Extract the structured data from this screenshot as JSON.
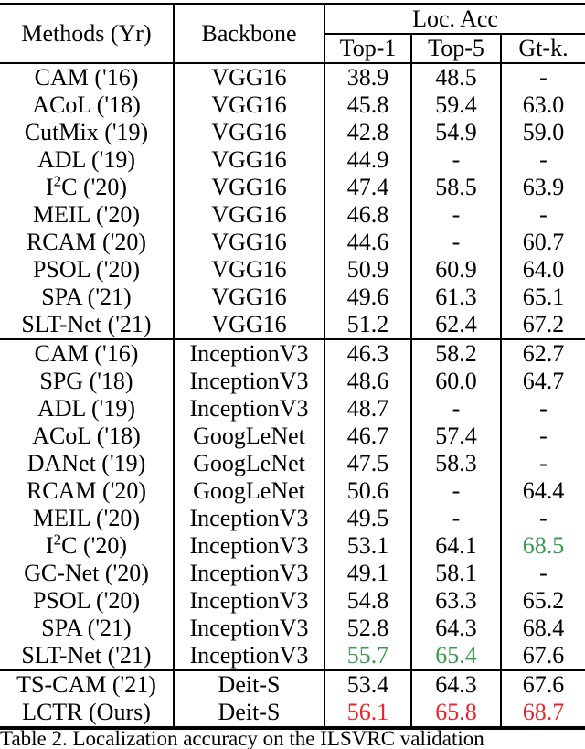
{
  "table": {
    "columns": {
      "methods": "Methods (Yr)",
      "backbone": "Backbone",
      "group_header": "Loc. Acc",
      "top1": "Top-1",
      "top5": "Top-5",
      "gtk": "Gt-k."
    },
    "colors": {
      "green": "#3a9b50",
      "red": "#e8252a",
      "rule": "#000000"
    },
    "groups": [
      {
        "name": "vgg16-group",
        "rows": [
          {
            "method": "CAM",
            "year": "('16)",
            "sup": "",
            "backbone": "VGG16",
            "top1": "38.9",
            "top5": "48.5",
            "gtk": "-",
            "top1_style": "",
            "top5_style": "",
            "gtk_style": ""
          },
          {
            "method": "ACoL",
            "year": "('18)",
            "sup": "",
            "backbone": "VGG16",
            "top1": "45.8",
            "top5": "59.4",
            "gtk": "63.0",
            "top1_style": "",
            "top5_style": "",
            "gtk_style": ""
          },
          {
            "method": "CutMix",
            "year": "('19)",
            "sup": "",
            "backbone": "VGG16",
            "top1": "42.8",
            "top5": "54.9",
            "gtk": "59.0",
            "top1_style": "",
            "top5_style": "",
            "gtk_style": ""
          },
          {
            "method": "ADL",
            "year": "('19)",
            "sup": "",
            "backbone": "VGG16",
            "top1": "44.9",
            "top5": "-",
            "gtk": "-",
            "top1_style": "",
            "top5_style": "",
            "gtk_style": ""
          },
          {
            "method": "I",
            "year": "('20)",
            "sup": "2",
            "method_tail": "C",
            "backbone": "VGG16",
            "top1": "47.4",
            "top5": "58.5",
            "gtk": "63.9",
            "top1_style": "",
            "top5_style": "",
            "gtk_style": ""
          },
          {
            "method": "MEIL",
            "year": "('20)",
            "sup": "",
            "backbone": "VGG16",
            "top1": "46.8",
            "top5": "-",
            "gtk": "-",
            "top1_style": "",
            "top5_style": "",
            "gtk_style": ""
          },
          {
            "method": "RCAM",
            "year": "('20)",
            "sup": "",
            "backbone": "VGG16",
            "top1": "44.6",
            "top5": "-",
            "gtk": "60.7",
            "top1_style": "",
            "top5_style": "",
            "gtk_style": ""
          },
          {
            "method": "PSOL",
            "year": "('20)",
            "sup": "",
            "backbone": "VGG16",
            "top1": "50.9",
            "top5": "60.9",
            "gtk": "64.0",
            "top1_style": "",
            "top5_style": "",
            "gtk_style": ""
          },
          {
            "method": "SPA",
            "year": "('21)",
            "sup": "",
            "backbone": "VGG16",
            "top1": "49.6",
            "top5": "61.3",
            "gtk": "65.1",
            "top1_style": "",
            "top5_style": "",
            "gtk_style": ""
          },
          {
            "method": "SLT-Net",
            "year": "('21)",
            "sup": "",
            "backbone": "VGG16",
            "top1": "51.2",
            "top5": "62.4",
            "gtk": "67.2",
            "top1_style": "",
            "top5_style": "",
            "gtk_style": ""
          }
        ]
      },
      {
        "name": "inception-googlenet-group",
        "rows": [
          {
            "method": "CAM",
            "year": "('16)",
            "sup": "",
            "backbone": "InceptionV3",
            "top1": "46.3",
            "top5": "58.2",
            "gtk": "62.7",
            "top1_style": "",
            "top5_style": "",
            "gtk_style": ""
          },
          {
            "method": "SPG",
            "year": "('18)",
            "sup": "",
            "backbone": "InceptionV3",
            "top1": "48.6",
            "top5": "60.0",
            "gtk": "64.7",
            "top1_style": "",
            "top5_style": "",
            "gtk_style": ""
          },
          {
            "method": "ADL",
            "year": "('19)",
            "sup": "",
            "backbone": "InceptionV3",
            "top1": "48.7",
            "top5": "-",
            "gtk": "-",
            "top1_style": "",
            "top5_style": "",
            "gtk_style": ""
          },
          {
            "method": "ACoL",
            "year": "('18)",
            "sup": "",
            "backbone": "GoogLeNet",
            "top1": "46.7",
            "top5": "57.4",
            "gtk": "-",
            "top1_style": "",
            "top5_style": "",
            "gtk_style": ""
          },
          {
            "method": "DANet",
            "year": "('19)",
            "sup": "",
            "backbone": "GoogLeNet",
            "top1": "47.5",
            "top5": "58.3",
            "gtk": "-",
            "top1_style": "",
            "top5_style": "",
            "gtk_style": ""
          },
          {
            "method": "RCAM",
            "year": "('20)",
            "sup": "",
            "backbone": "GoogLeNet",
            "top1": "50.6",
            "top5": "-",
            "gtk": "64.4",
            "top1_style": "",
            "top5_style": "",
            "gtk_style": ""
          },
          {
            "method": "MEIL",
            "year": "('20)",
            "sup": "",
            "backbone": "InceptionV3",
            "top1": "49.5",
            "top5": "-",
            "gtk": "-",
            "top1_style": "",
            "top5_style": "",
            "gtk_style": ""
          },
          {
            "method": "I",
            "year": "('20)",
            "sup": "2",
            "method_tail": "C",
            "backbone": "InceptionV3",
            "top1": "53.1",
            "top5": "64.1",
            "gtk": "68.5",
            "top1_style": "",
            "top5_style": "",
            "gtk_style": "green"
          },
          {
            "method": "GC-Net",
            "year": "('20)",
            "sup": "",
            "backbone": "InceptionV3",
            "top1": "49.1",
            "top5": "58.1",
            "gtk": "-",
            "top1_style": "",
            "top5_style": "",
            "gtk_style": ""
          },
          {
            "method": "PSOL",
            "year": "('20)",
            "sup": "",
            "backbone": "InceptionV3",
            "top1": "54.8",
            "top5": "63.3",
            "gtk": "65.2",
            "top1_style": "",
            "top5_style": "",
            "gtk_style": ""
          },
          {
            "method": "SPA",
            "year": "('21)",
            "sup": "",
            "backbone": "InceptionV3",
            "top1": "52.8",
            "top5": "64.3",
            "gtk": "68.4",
            "top1_style": "",
            "top5_style": "",
            "gtk_style": ""
          },
          {
            "method": "SLT-Net",
            "year": "('21)",
            "sup": "",
            "backbone": "InceptionV3",
            "top1": "55.7",
            "top5": "65.4",
            "gtk": "67.6",
            "top1_style": "green",
            "top5_style": "green",
            "gtk_style": ""
          }
        ]
      },
      {
        "name": "deit-group",
        "rows": [
          {
            "method": "TS-CAM",
            "year": "('21)",
            "sup": "",
            "backbone": "Deit-S",
            "top1": "53.4",
            "top5": "64.3",
            "gtk": "67.6",
            "top1_style": "",
            "top5_style": "",
            "gtk_style": ""
          },
          {
            "method": "LCTR",
            "year": "(Ours)",
            "sup": "",
            "backbone": "Deit-S",
            "top1": "56.1",
            "top5": "65.8",
            "gtk": "68.7",
            "top1_style": "red",
            "top5_style": "red",
            "gtk_style": "red"
          }
        ]
      }
    ]
  },
  "caption": {
    "text": "Table 2. Localization accuracy on the ILSVRC validation"
  }
}
